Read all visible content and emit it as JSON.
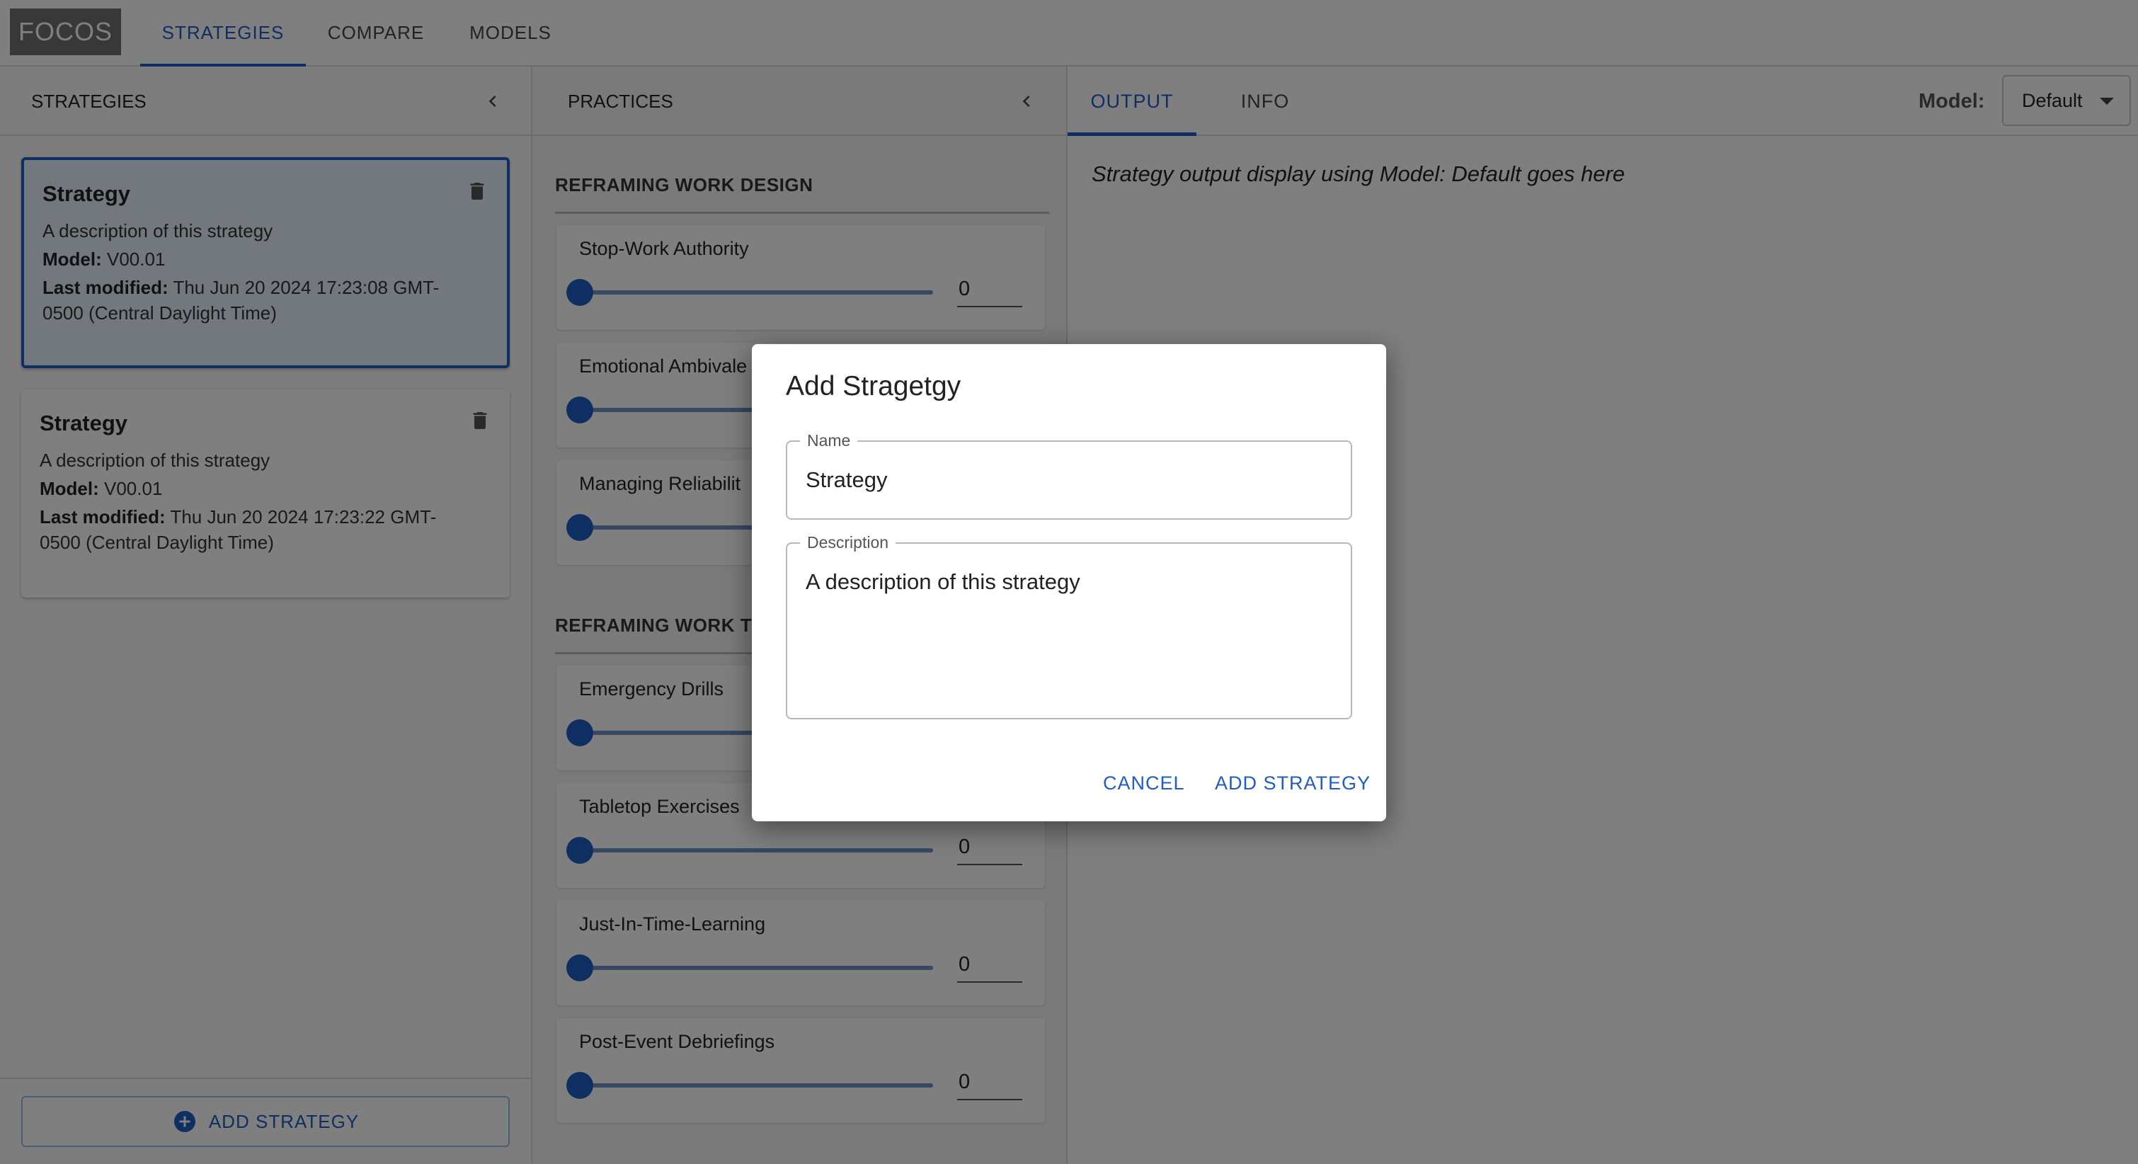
{
  "app": {
    "logo": "FOCOS",
    "nav": [
      "STRATEGIES",
      "COMPARE",
      "MODELS"
    ],
    "active_nav": "STRATEGIES",
    "accent_color": "#1f5cc5"
  },
  "strategies_panel": {
    "title": "STRATEGIES",
    "collapse_icon": "chevron-left-icon",
    "cards": [
      {
        "title": "Strategy",
        "description": "A description of this strategy",
        "model_label": "Model:",
        "model": "V00.01",
        "modified_label": "Last modified:",
        "modified_line1": "Thu Jun 20 2024 17:23:08 GMT-",
        "modified_line2": "0500 (Central Daylight Time)",
        "selected": true
      },
      {
        "title": "Strategy",
        "description": "A description of this strategy",
        "model_label": "Model:",
        "model": "V00.01",
        "modified_label": "Last modified:",
        "modified_line1": "Thu Jun 20 2024 17:23:22 GMT-",
        "modified_line2": "0500 (Central Daylight Time)",
        "selected": false
      }
    ],
    "add_button": "ADD STRATEGY"
  },
  "practices_panel": {
    "title": "PRACTICES",
    "sections": [
      {
        "title": "REFRAMING WORK DESIGN",
        "items": [
          {
            "label": "Stop-Work Authority",
            "value": "0"
          },
          {
            "label": "Emotional Ambivale",
            "value": "0"
          },
          {
            "label": "Managing Reliabilit",
            "value": "0"
          }
        ]
      },
      {
        "title": "REFRAMING WORK TI",
        "items": [
          {
            "label": "Emergency Drills",
            "value": "0"
          },
          {
            "label": "Tabletop Exercises",
            "value": "0"
          },
          {
            "label": "Just-In-Time-Learning",
            "value": "0"
          },
          {
            "label": "Post-Event Debriefings",
            "value": "0"
          }
        ]
      }
    ]
  },
  "output_panel": {
    "tabs": [
      "OUTPUT",
      "INFO"
    ],
    "active_tab": "OUTPUT",
    "model_label": "Model:",
    "model_value": "Default",
    "output_text": "Strategy output display using Model: Default goes here"
  },
  "dialog": {
    "title": "Add Stragetgy",
    "name_label": "Name",
    "name_value": "Strategy",
    "description_label": "Description",
    "description_value": "A description of this strategy",
    "cancel_label": "CANCEL",
    "confirm_label": "ADD STRATEGY"
  }
}
